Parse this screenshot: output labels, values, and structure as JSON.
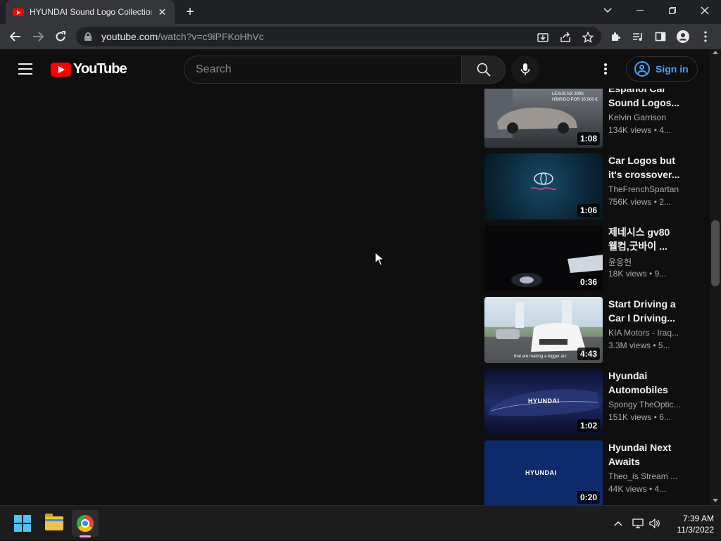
{
  "browser": {
    "tab_title": "HYUNDAI Sound Logo Collection",
    "tab_close": "✕",
    "new_tab": "+",
    "url_host": "youtube.com",
    "url_path": "/watch?v=c9iPFKoHhVc"
  },
  "header": {
    "logo_text": "YouTube",
    "search_placeholder": "Search",
    "sign_in": "Sign in"
  },
  "recommendations": [
    {
      "title": "Español Car Sound Logos...",
      "channel": "Kelvin Garrison",
      "views": "134K views",
      "age": "4...",
      "duration": "1:08",
      "thumb_bg": "#5a5f66",
      "thumb_overlay": "LEXUS NX 300h HÍBRIDO POR 35.900 €"
    },
    {
      "title": "Car Logos but it's crossover...",
      "channel": "TheFrenchSpartan",
      "views": "756K views",
      "age": "2...",
      "duration": "1:06",
      "thumb_bg": "#0b2a3c",
      "thumb_overlay": ""
    },
    {
      "title": "제네시스 gv80 웰컴,굿바이 ...",
      "channel": "윤응헌",
      "views": "18K views",
      "age": "9...",
      "duration": "0:36",
      "thumb_bg": "#070709",
      "thumb_overlay": ""
    },
    {
      "title": "Start Driving a Car l Driving...",
      "channel": "KIA Motors - Iraq...",
      "views": "3.3M views",
      "age": "5...",
      "duration": "4:43",
      "thumb_bg": "#c9dbe6",
      "thumb_overlay": "that are making a bigger arc"
    },
    {
      "title": "Hyundai Automobiles",
      "channel": "Spongy TheOptic...",
      "views": "151K views",
      "age": "6...",
      "duration": "1:02",
      "thumb_bg": "#16204a",
      "thumb_overlay": "HYUNDAI"
    },
    {
      "title": "Hyundai Next Awaits",
      "channel": "Theo_is Stream ...",
      "views": "44K views",
      "age": "4...",
      "duration": "0:20",
      "thumb_bg": "#0d2a6b",
      "thumb_overlay": "HYUNDAI"
    }
  ],
  "taskbar": {
    "time": "7:39 AM",
    "date": "11/3/2022"
  },
  "colors": {
    "yt_red": "#ff0000",
    "accent_blue": "#3ea6ff",
    "page_bg": "#0f0f0f"
  }
}
